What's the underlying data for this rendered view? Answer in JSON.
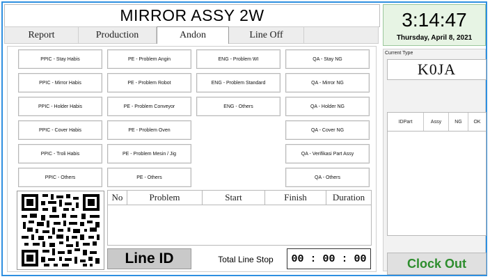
{
  "header": {
    "title": "MIRROR ASSY 2W"
  },
  "tabs": [
    {
      "label": "Report"
    },
    {
      "label": "Production"
    },
    {
      "label": "Andon",
      "active": true
    },
    {
      "label": "Line Off"
    }
  ],
  "andon": {
    "ppic": [
      "PPIC - Stay Habis",
      "PPIC - Mirror Habis",
      "PPIC - Holder Habis",
      "PPIC - Cover Habis",
      "PPIC - Troli Habis",
      "PPIC - Others"
    ],
    "pe": [
      "PE - Problem Angin",
      "PE - Problem Robot",
      "PE - Problem Conveyor",
      "PE - Problem Oven",
      "PE - Problem Mesin / Jig",
      "PE - Others"
    ],
    "eng": [
      "ENG - Problem WI",
      "ENG - Problem Standard",
      "ENG - Others"
    ],
    "qa": [
      "QA - Stay NG",
      "QA - Mirror NG",
      "QA - Holder NG",
      "QA - Cover NG",
      "QA - Verifikasi Part Assy",
      "QA - Others"
    ]
  },
  "problem_table": {
    "columns": [
      "No",
      "Problem",
      "Start",
      "Finish",
      "Duration"
    ],
    "rows": []
  },
  "line": {
    "line_id_label": "Line ID",
    "total_stop_label": "Total Line Stop",
    "total_stop_value": "00 : 00 : 00"
  },
  "clock": {
    "time": "3:14:47",
    "date": "Thursday, April 8, 2021"
  },
  "current_type": {
    "label": "Current Type",
    "value": "K0JA"
  },
  "parts_table": {
    "columns": [
      "IDPart",
      "Assy",
      "NG",
      "OK"
    ],
    "rows": []
  },
  "clock_out": {
    "label": "Clock Out"
  },
  "colors": {
    "frame_border": "#2e8fe0",
    "clock_bg": "#e7f4e4",
    "clock_out_text": "#2d8d2d",
    "line_id_bg": "#c9c9c9"
  }
}
